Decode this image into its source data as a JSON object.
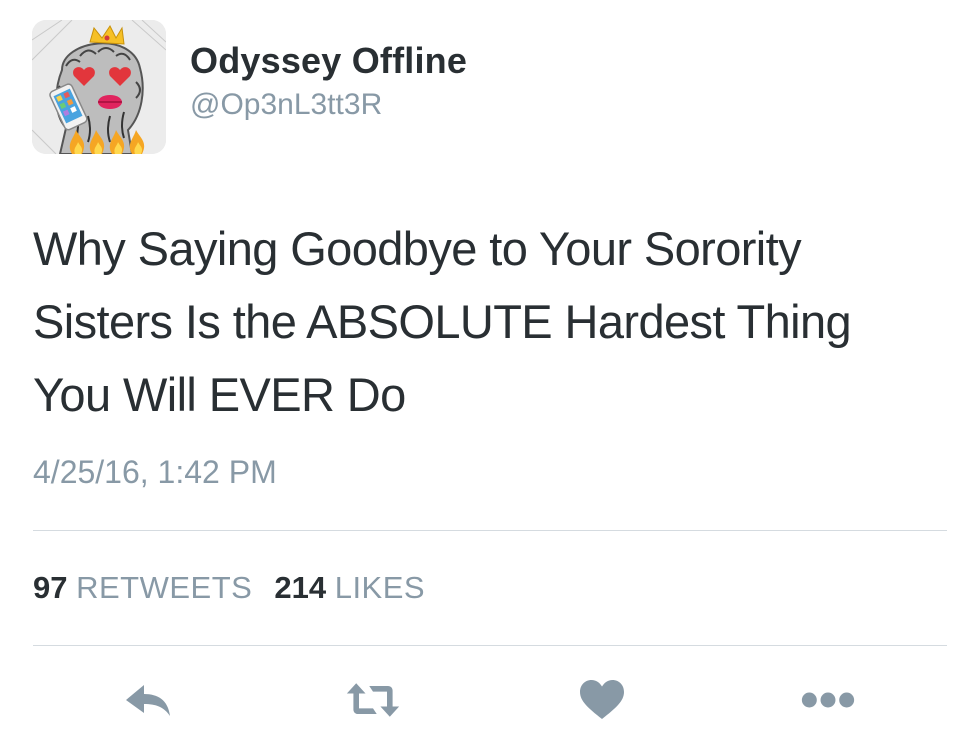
{
  "tweet": {
    "display_name": "Odyssey Offline",
    "handle": "@Op3nL3tt3R",
    "text_lines": [
      "Why Saying Goodbye to Your Sorority",
      "Sisters Is the ABSOLUTE Hardest Thing",
      "You Will EVER Do"
    ],
    "timestamp": "4/25/16, 1:42 PM"
  },
  "stats": {
    "retweets_count": "97",
    "retweets_label": "RETWEETS",
    "likes_count": "214",
    "likes_label": "LIKES"
  },
  "actions": [
    {
      "icon": "reply-icon"
    },
    {
      "icon": "retweet-icon"
    },
    {
      "icon": "heart-icon"
    },
    {
      "icon": "more-icon"
    }
  ],
  "colors": {
    "text": "#292f33",
    "secondary": "#8899a6",
    "divider": "#d5dbe0",
    "icon": "#8899a6"
  }
}
